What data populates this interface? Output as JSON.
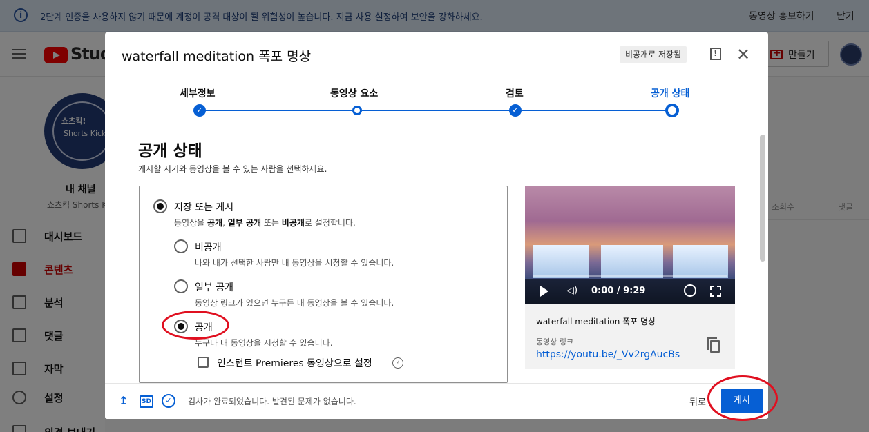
{
  "banner": {
    "message": "2단계 인증을 사용하지 않기 때문에 계정이 공격 대상이 될 위험성이 높습니다. 지금 사용 설정하여 보안을 강화하세요.",
    "promote": "동영상 홍보하기",
    "close": "닫기"
  },
  "topbar": {
    "studio": "Studio",
    "create": "만들기"
  },
  "sidebar": {
    "avatar_line1": "쇼츠킥!",
    "avatar_line2": "Shorts Kick",
    "channel_title": "내 채널",
    "channel_name": "쇼츠킥 Shorts K",
    "items": [
      {
        "label": "대시보드",
        "active": false
      },
      {
        "label": "콘텐츠",
        "active": true
      },
      {
        "label": "분석",
        "active": false
      },
      {
        "label": "댓글",
        "active": false
      },
      {
        "label": "자막",
        "active": false
      },
      {
        "label": "설정",
        "active": false
      },
      {
        "label": "의견 보내기",
        "active": false
      }
    ]
  },
  "background_columns": {
    "views": "조회수",
    "comments": "댓글"
  },
  "dialog": {
    "title": "waterfall meditation 폭포 명상",
    "saved_badge": "비공개로 저장됨",
    "steps": [
      {
        "label": "세부정보",
        "state": "done"
      },
      {
        "label": "동영상 요소",
        "state": "visited"
      },
      {
        "label": "검토",
        "state": "done"
      },
      {
        "label": "공개 상태",
        "state": "current"
      }
    ],
    "section_title": "공개 상태",
    "section_sub": "게시할 시기와 동영상을 볼 수 있는 사람을 선택하세요.",
    "save_publish": {
      "title": "저장 또는 게시",
      "desc_pre": "동영상을 ",
      "desc_b1": "공개",
      "desc_sep1": ", ",
      "desc_b2": "일부 공개",
      "desc_mid": " 또는 ",
      "desc_b3": "비공개",
      "desc_post": "로 설정합니다."
    },
    "options": [
      {
        "title": "비공개",
        "desc": "나와 내가 선택한 사람만 내 동영상을 시청할 수 있습니다.",
        "selected": false
      },
      {
        "title": "일부 공개",
        "desc": "동영상 링크가 있으면 누구든 내 동영상을 볼 수 있습니다.",
        "selected": false
      },
      {
        "title": "공개",
        "desc": "누구나 내 동영상을 시청할 수 있습니다.",
        "selected": true
      }
    ],
    "premiere_label": "인스턴트 Premieres 동영상으로 설정",
    "help": "?",
    "video": {
      "time": "0:00 / 9:29",
      "title": "waterfall meditation 폭포 명상",
      "link_label": "동영상 링크",
      "link": "https://youtu.be/_Vv2rgAucBs"
    },
    "footer": {
      "sd": "SD",
      "status": "검사가 완료되었습니다. 발견된 문제가 없습니다.",
      "back": "뒤로",
      "publish": "게시"
    }
  },
  "colors": {
    "accent": "#065fd4",
    "annotation": "#e01020",
    "brand_red": "#ff0000"
  }
}
